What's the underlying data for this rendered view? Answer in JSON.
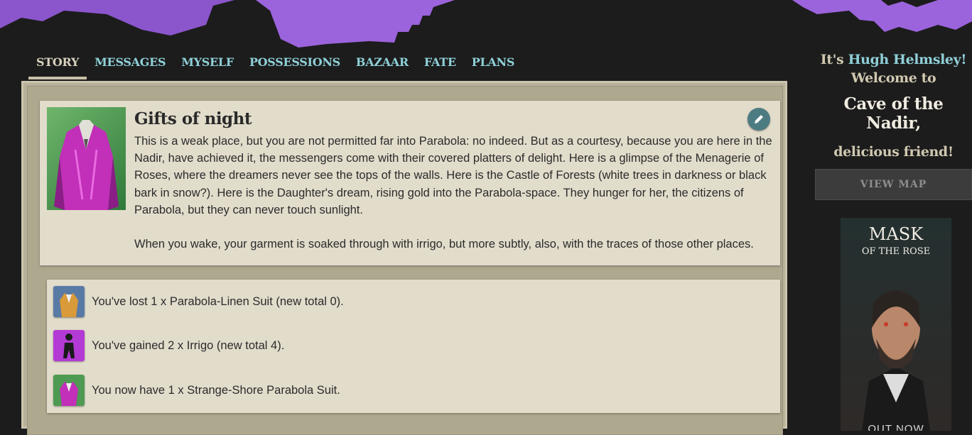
{
  "nav": {
    "tabs": [
      {
        "label": "STORY",
        "active": true
      },
      {
        "label": "MESSAGES"
      },
      {
        "label": "MYSELF"
      },
      {
        "label": "POSSESSIONS"
      },
      {
        "label": "BAZAAR"
      },
      {
        "label": "FATE"
      },
      {
        "label": "PLANS"
      }
    ]
  },
  "storylet": {
    "title": "Gifts of night",
    "paragraphs": [
      "This is a weak place, but you are not permitted far into Parabola: no indeed. But as a courtesy, because you are here in the Nadir, have achieved it, the messengers come with their covered platters of delight. Here is a glimpse of the Menagerie of Roses, where the dreamers never see the tops of the walls. Here is the Castle of Forests (white trees in darkness or black bark in snow?). Here is the Daughter's dream, rising gold into the Parabola-space. They hunger for her, the citizens of Parabola, but they can never touch sunlight.",
      "When you wake, your garment is soaked through with irrigo, but more subtly, also, with the traces of those other places."
    ],
    "image_icon": "parabola-suit-icon",
    "edit_icon": "pencil-icon"
  },
  "results": [
    {
      "text": "You've lost 1 x Parabola-Linen Suit (new total 0).",
      "icon": "linen-suit-icon"
    },
    {
      "text": "You've gained 2 x Irrigo (new total 4).",
      "icon": "irrigo-figure-icon"
    },
    {
      "text": "You now have 1 x Strange-Shore Parabola Suit.",
      "icon": "parabola-suit-icon"
    }
  ],
  "sidebar": {
    "greeting_prefix": "It's ",
    "character_name": "Hugh Helmsley!",
    "welcome_to": "Welcome to",
    "location": "Cave of the Nadir,",
    "friend": "delicious friend!",
    "view_map_label": "VIEW MAP"
  },
  "ad": {
    "title_top": "MASK",
    "title_bottom": "OF THE ROSE",
    "cta": "OUT NOW"
  },
  "colors": {
    "nav_link": "#8fd0d8",
    "nav_active": "#d8d1bd",
    "banner_purple": "#9b5fd6",
    "paper": "#e2dccb",
    "frame": "#b7b19b"
  }
}
